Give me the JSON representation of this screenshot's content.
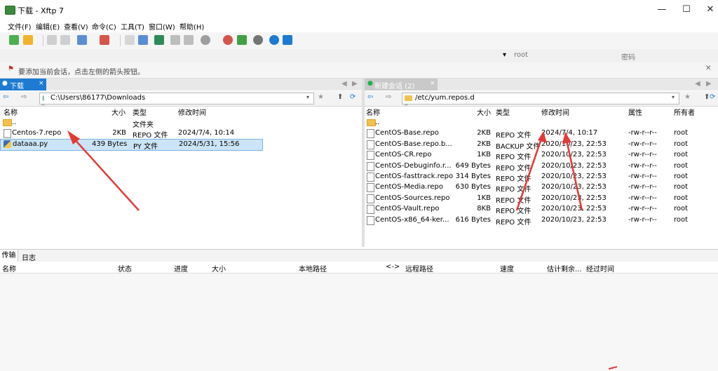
{
  "window": {
    "title": "下载 - Xftp 7",
    "minimize": "—",
    "maximize": "☐",
    "close": "✕"
  },
  "menu": [
    "文件(F)",
    "编辑(E)",
    "查看(V)",
    "命令(C)",
    "工具(T)",
    "窗口(W)",
    "帮助(H)"
  ],
  "address": {
    "user_placeholder": "root",
    "password_placeholder": "密码",
    "dropdown": "▾"
  },
  "tip": "要添加当前会话，点击左侧的箭头按钮。",
  "left": {
    "tab": "下载",
    "path": "C:\\Users\\86177\\Downloads",
    "columns": [
      "名称",
      "大小",
      "类型",
      "修改时间"
    ],
    "rows": [
      {
        "name": "..",
        "size": "",
        "type": "文件夹",
        "time": "",
        "icon": "folder-icon"
      },
      {
        "name": "Centos-7.repo",
        "size": "2KB",
        "type": "REPO 文件",
        "time": "2024/7/4, 10:14",
        "icon": "file-icon"
      },
      {
        "name": "dataaa.py",
        "size": "439 Bytes",
        "type": "PY 文件",
        "time": "2024/5/31, 15:56",
        "icon": "python-file-icon"
      }
    ]
  },
  "right": {
    "tab": "新建会话 (2)",
    "path": "/etc/yum.repos.d",
    "columns": [
      "名称",
      "大小",
      "类型",
      "修改时间",
      "属性",
      "所有者"
    ],
    "rows": [
      {
        "name": "..",
        "size": "",
        "type": "",
        "time": "",
        "attr": "",
        "owner": "",
        "icon": "folder-icon"
      },
      {
        "name": "CentOS-Base.repo",
        "size": "2KB",
        "type": "REPO 文件",
        "time": "2024/7/4, 10:17",
        "attr": "-rw-r--r--",
        "owner": "root",
        "icon": "file-icon"
      },
      {
        "name": "CentOS-Base.repo.b...",
        "size": "2KB",
        "type": "BACKUP 文件",
        "time": "2020/10/23, 22:53",
        "attr": "-rw-r--r--",
        "owner": "root",
        "icon": "file-icon"
      },
      {
        "name": "CentOS-CR.repo",
        "size": "1KB",
        "type": "REPO 文件",
        "time": "2020/10/23, 22:53",
        "attr": "-rw-r--r--",
        "owner": "root",
        "icon": "file-icon"
      },
      {
        "name": "CentOS-Debuginfo.r...",
        "size": "649 Bytes",
        "type": "REPO 文件",
        "time": "2020/10/23, 22:53",
        "attr": "-rw-r--r--",
        "owner": "root",
        "icon": "file-icon"
      },
      {
        "name": "CentOS-fasttrack.repo",
        "size": "314 Bytes",
        "type": "REPO 文件",
        "time": "2020/10/23, 22:53",
        "attr": "-rw-r--r--",
        "owner": "root",
        "icon": "file-icon"
      },
      {
        "name": "CentOS-Media.repo",
        "size": "630 Bytes",
        "type": "REPO 文件",
        "time": "2020/10/23, 22:53",
        "attr": "-rw-r--r--",
        "owner": "root",
        "icon": "file-icon"
      },
      {
        "name": "CentOS-Sources.repo",
        "size": "1KB",
        "type": "REPO 文件",
        "time": "2020/10/23, 22:53",
        "attr": "-rw-r--r--",
        "owner": "root",
        "icon": "file-icon"
      },
      {
        "name": "CentOS-Vault.repo",
        "size": "8KB",
        "type": "REPO 文件",
        "time": "2020/10/23, 22:53",
        "attr": "-rw-r--r--",
        "owner": "root",
        "icon": "file-icon"
      },
      {
        "name": "CentOS-x86_64-ker...",
        "size": "616 Bytes",
        "type": "REPO 文件",
        "time": "2020/10/23, 22:53",
        "attr": "-rw-r--r--",
        "owner": "root",
        "icon": "file-icon"
      }
    ]
  },
  "bottom": {
    "tabs": [
      "传输",
      "日志"
    ],
    "columns": [
      "名称",
      "状态",
      "进度",
      "大小",
      "本地路径",
      "<->",
      "远程路径",
      "速度",
      "估计剩余...",
      "经过时间"
    ]
  },
  "colors": {
    "accent": "#1e7bd1",
    "selection": "#cce4f7",
    "annotation": "#e53935"
  }
}
